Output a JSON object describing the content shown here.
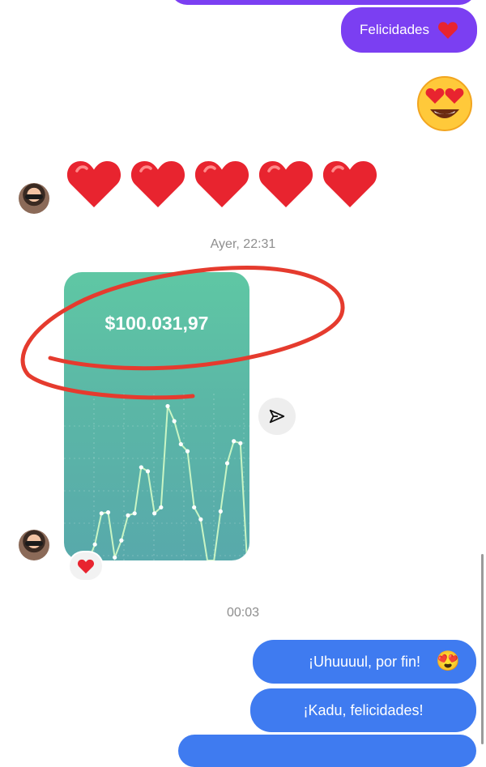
{
  "messages": {
    "top_purple_label": "Felicidades",
    "heart_emoji": "❤️",
    "heart_row_count": 5
  },
  "separators": {
    "first": "Ayer, 22:31",
    "second": "00:03"
  },
  "shared_card": {
    "amount": "$100.031,97",
    "chart_data": {
      "type": "line",
      "x": [
        0,
        1,
        2,
        3,
        4,
        5,
        6,
        7,
        8,
        9,
        10,
        11,
        12,
        13,
        14,
        15,
        16,
        17,
        18,
        19,
        20,
        21,
        22,
        23,
        24
      ],
      "values": [
        0,
        16,
        47,
        48,
        3,
        20,
        45,
        47,
        93,
        89,
        47,
        53,
        154,
        139,
        116,
        109,
        53,
        41,
        0,
        0,
        49,
        97,
        119,
        117,
        0
      ],
      "title": "",
      "xlabel": "",
      "ylabel": ""
    }
  },
  "sent": {
    "msg1": "¡Uhuuuul, por fin!",
    "msg1_emoji": "😍",
    "msg2": "¡Kadu, felicidades!"
  },
  "colors": {
    "purple_bubble": "#7b3ff2",
    "blue_bubble": "#3f7bf0",
    "annotation_red": "#e53b2e",
    "chart_line": "#c9f5c4"
  },
  "icons": {
    "share": "paper-plane-icon",
    "emoji_large": "smiling-face-with-heart-eyes-icon"
  }
}
